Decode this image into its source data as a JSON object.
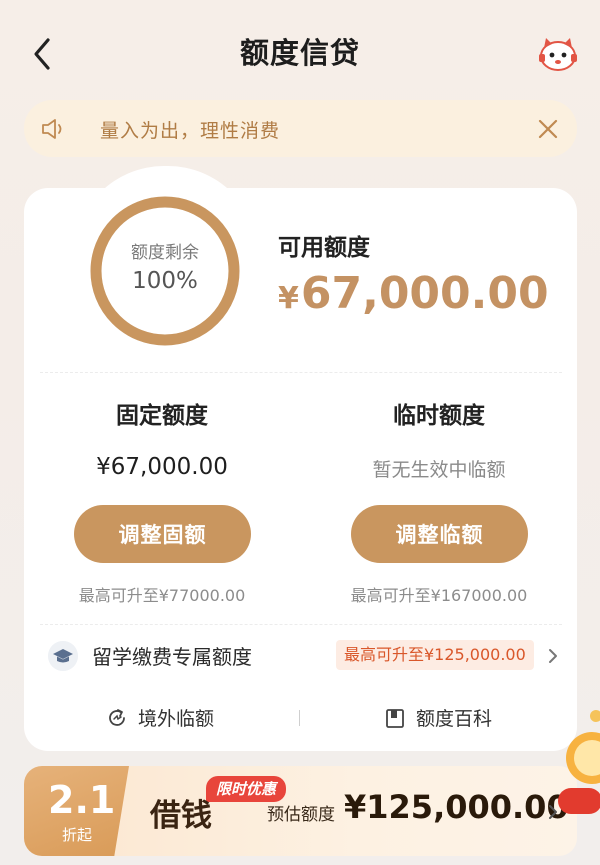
{
  "header": {
    "title": "额度信贷",
    "back_icon": "chevron-left-icon",
    "avatar_icon": "mascot-icon"
  },
  "notice": {
    "text": "量入为出，理性消费",
    "icon": "speaker-icon",
    "close_icon": "close-icon"
  },
  "summary": {
    "ring_label": "额度剩余",
    "ring_value": "100%",
    "remaining_fraction": 1.0,
    "available_label": "可用额度",
    "available_currency": "¥",
    "available_amount": "67,000.00"
  },
  "fixed": {
    "title": "固定额度",
    "amount": "¥67,000.00",
    "button": "调整固额",
    "max_text": "最高可升至¥77000.00"
  },
  "temporary": {
    "title": "临时额度",
    "empty_text": "暂无生效中临额",
    "button": "调整临额",
    "max_text": "最高可升至¥167000.00"
  },
  "study": {
    "label": "留学缴费专属额度",
    "tag": "最高可升至¥125,000.00",
    "icon": "graduation-cap-icon"
  },
  "links": [
    {
      "label": "境外临额",
      "icon": "globe-refresh-icon"
    },
    {
      "label": "额度百科",
      "icon": "book-icon"
    }
  ],
  "promo": {
    "rate": "2.1",
    "rate_suffix": "折起",
    "badge": "限时优惠",
    "title": "借钱",
    "estimate_label": "预估额度",
    "estimate_value": "¥125,000.00"
  },
  "colors": {
    "accent_gold": "#c9965f",
    "amount_gold": "#c49263",
    "notice_bg": "#fbf0df",
    "notice_text": "#b07c45",
    "tag_red": "#d9572a",
    "badge_red": "#e8453b"
  }
}
